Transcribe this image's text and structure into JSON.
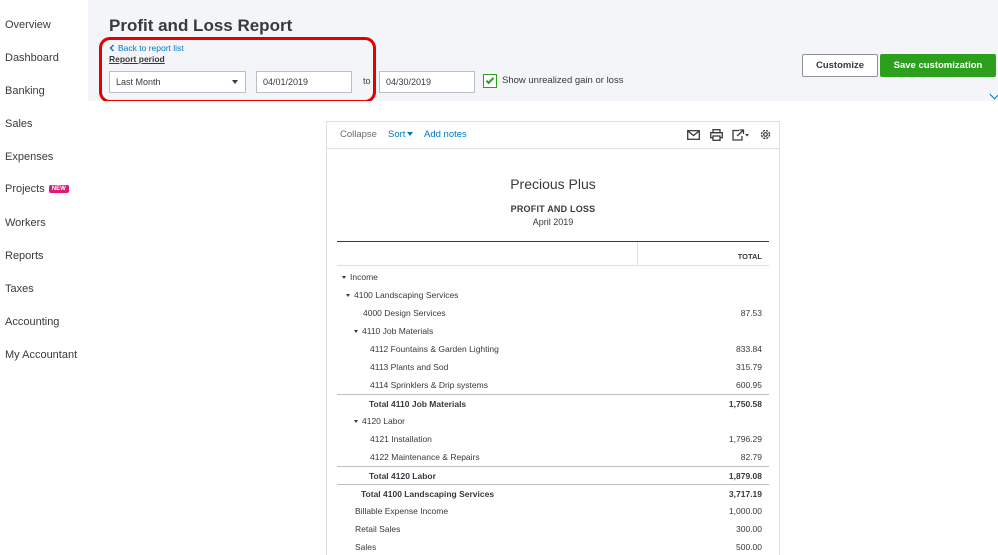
{
  "sidebar": {
    "items": [
      {
        "label": "Overview"
      },
      {
        "label": "Dashboard"
      },
      {
        "label": "Banking"
      },
      {
        "label": "Sales"
      },
      {
        "label": "Expenses"
      },
      {
        "label": "Projects",
        "badge": "NEW"
      },
      {
        "label": "Workers"
      },
      {
        "label": "Reports"
      },
      {
        "label": "Taxes"
      },
      {
        "label": "Accounting"
      },
      {
        "label": "My Accountant"
      }
    ]
  },
  "header": {
    "title": "Profit and Loss Report",
    "back_link": "Back to report list",
    "report_period_label": "Report period",
    "period_select": "Last Month",
    "date_from": "04/01/2019",
    "to_label": "to",
    "date_to": "04/30/2019",
    "unrealized_checkbox": {
      "label": "Show unrealized gain or loss",
      "checked": true
    },
    "customize_button": "Customize",
    "save_button": "Save customization"
  },
  "report": {
    "toolbar": {
      "collapse": "Collapse",
      "sort": "Sort",
      "add_notes": "Add notes"
    },
    "company": "Precious Plus",
    "title": "PROFIT AND LOSS",
    "period": "April 2019",
    "column_header": "TOTAL",
    "rows": [
      {
        "label": "Income",
        "value": "",
        "bold": false,
        "toggle": true
      },
      {
        "label": "4100 Landscaping Services",
        "value": "",
        "bold": false,
        "toggle": true
      },
      {
        "label": "4000 Design Services",
        "value": "87.53",
        "bold": false,
        "toggle": false
      },
      {
        "label": "4110 Job Materials",
        "value": "",
        "bold": false,
        "toggle": true
      },
      {
        "label": "4112 Fountains & Garden Lighting",
        "value": "833.84",
        "bold": false,
        "toggle": false
      },
      {
        "label": "4113 Plants and Sod",
        "value": "315.79",
        "bold": false,
        "toggle": false
      },
      {
        "label": "4114 Sprinklers & Drip systems",
        "value": "600.95",
        "bold": false,
        "toggle": false
      },
      {
        "label": "Total 4110 Job Materials",
        "value": "1,750.58",
        "bold": true,
        "toggle": false
      },
      {
        "label": "4120 Labor",
        "value": "",
        "bold": false,
        "toggle": true
      },
      {
        "label": "4121 Installation",
        "value": "1,796.29",
        "bold": false,
        "toggle": false
      },
      {
        "label": "4122 Maintenance & Repairs",
        "value": "82.79",
        "bold": false,
        "toggle": false
      },
      {
        "label": "Total 4120 Labor",
        "value": "1,879.08",
        "bold": true,
        "toggle": false
      },
      {
        "label": "Total 4100 Landscaping Services",
        "value": "3,717.19",
        "bold": true,
        "toggle": false
      },
      {
        "label": "Billable Expense Income",
        "value": "1,000.00",
        "bold": false,
        "toggle": false
      },
      {
        "label": "Retail Sales",
        "value": "300.00",
        "bold": false,
        "toggle": false
      },
      {
        "label": "Sales",
        "value": "500.00",
        "bold": false,
        "toggle": false
      }
    ]
  },
  "colors": {
    "accent_green": "#2ca01c",
    "link_blue": "#0077c5",
    "highlight_red": "#e20000",
    "badge_pink": "#e0197a"
  },
  "icons": [
    "chevron-left-icon",
    "caret-down-icon",
    "checkmark-icon",
    "email-icon",
    "print-icon",
    "export-icon",
    "settings-gear-icon",
    "expand-triangle-icon"
  ]
}
